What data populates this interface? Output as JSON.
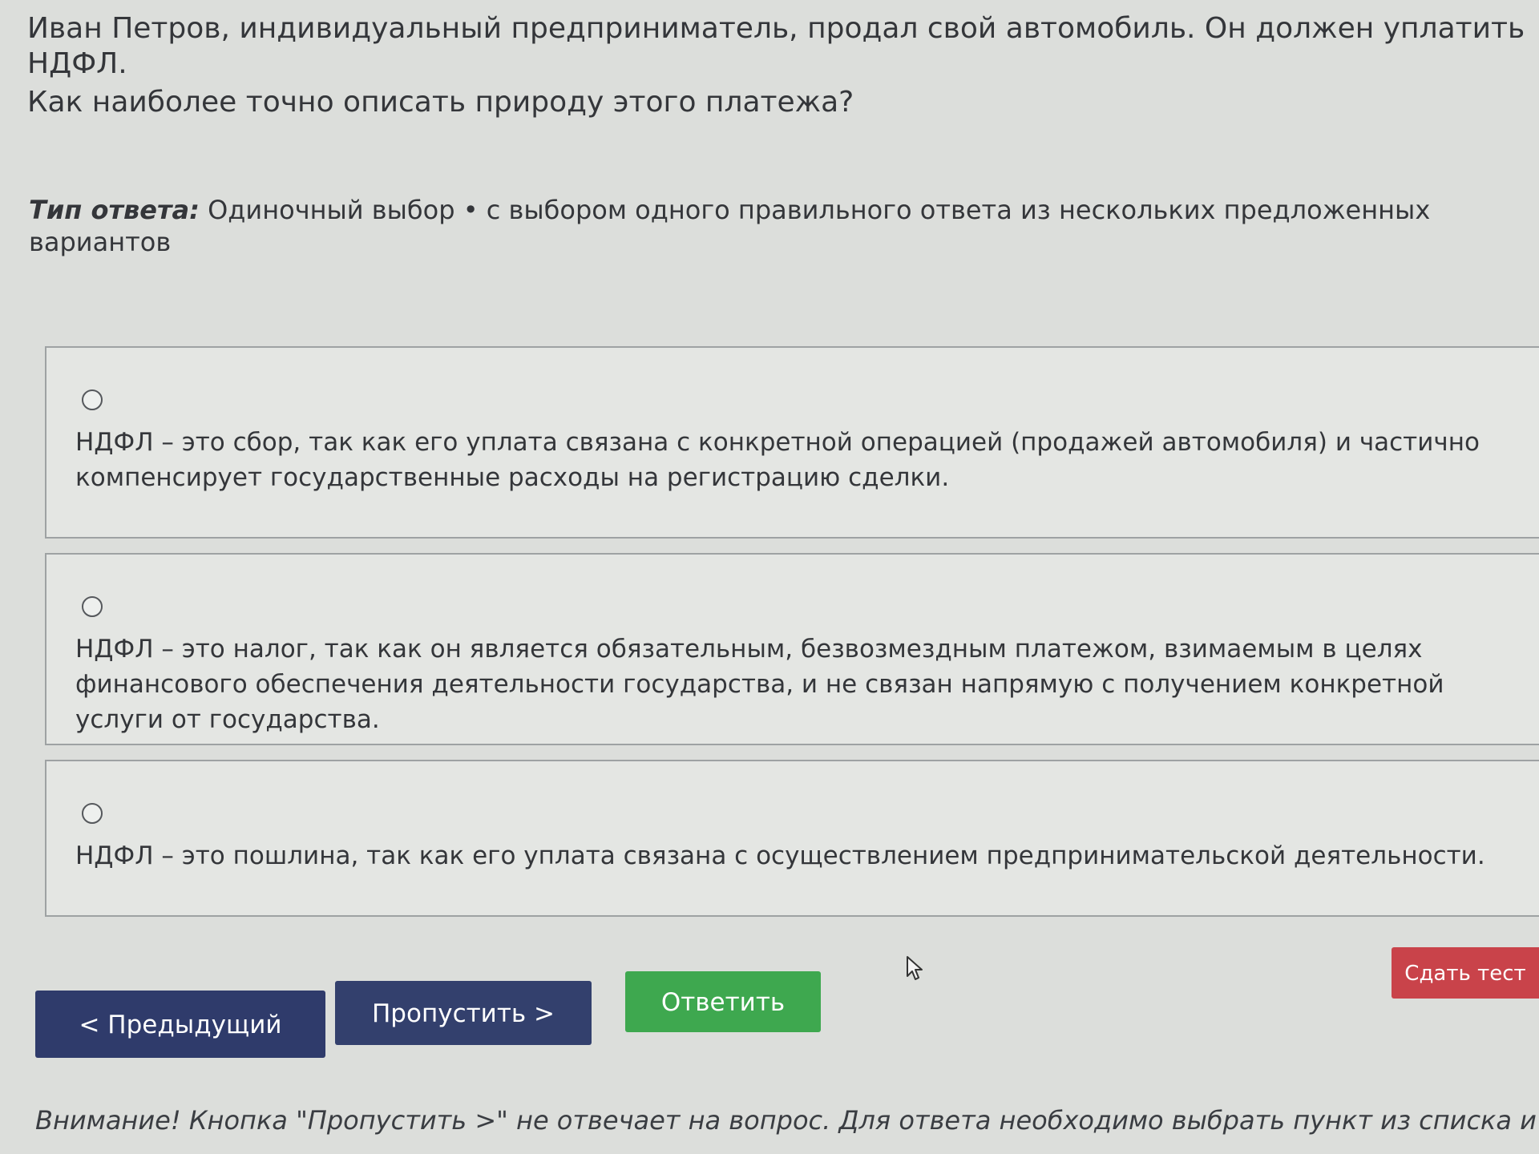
{
  "question": {
    "line1": "Иван Петров, индивидуальный предприниматель, продал свой автомобиль. Он должен уплатить НДФЛ.",
    "line2": "Как наиболее точно описать природу этого платежа?"
  },
  "answer_type": {
    "label": "Тип ответа:",
    "value": "Одиночный выбор • с выбором одного правильного ответа из нескольких предложенных вариантов"
  },
  "options": [
    {
      "text": "НДФЛ – это сбор, так как его уплата связана с конкретной операцией (продажей автомобиля) и частично компенсирует государственные расходы на регистрацию сделки."
    },
    {
      "text": "НДФЛ – это налог, так как он является обязательным, безвозмездным платежом, взимаемым в целях финансового обеспечения деятельности государства, и не связан напрямую с получением конкретной услуги от государства."
    },
    {
      "text": "НДФЛ – это пошлина, так как его уплата связана с осуществлением предпринимательской деятельности."
    }
  ],
  "buttons": {
    "previous": "< Предыдущий",
    "skip": "Пропустить >",
    "answer": "Ответить",
    "submit_test": "Сдать тест"
  },
  "notice": "Внимание! Кнопка \"Пропустить >\" не отвечает на вопрос. Для ответа необходимо выбрать пункт из списка и нажать",
  "colors": {
    "primary_button": "#2f3b6b",
    "answer_button": "#3ea84f",
    "submit_button": "#c9434a"
  }
}
